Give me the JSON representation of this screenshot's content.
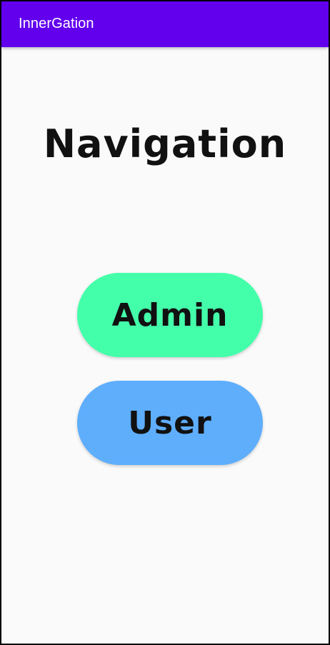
{
  "app_bar": {
    "title": "InnerGation",
    "color": "#6200ee"
  },
  "main": {
    "heading": "Navigation",
    "buttons": [
      {
        "label": "Admin",
        "color": "#44ffaa"
      },
      {
        "label": "User",
        "color": "#5eaefc"
      }
    ]
  }
}
